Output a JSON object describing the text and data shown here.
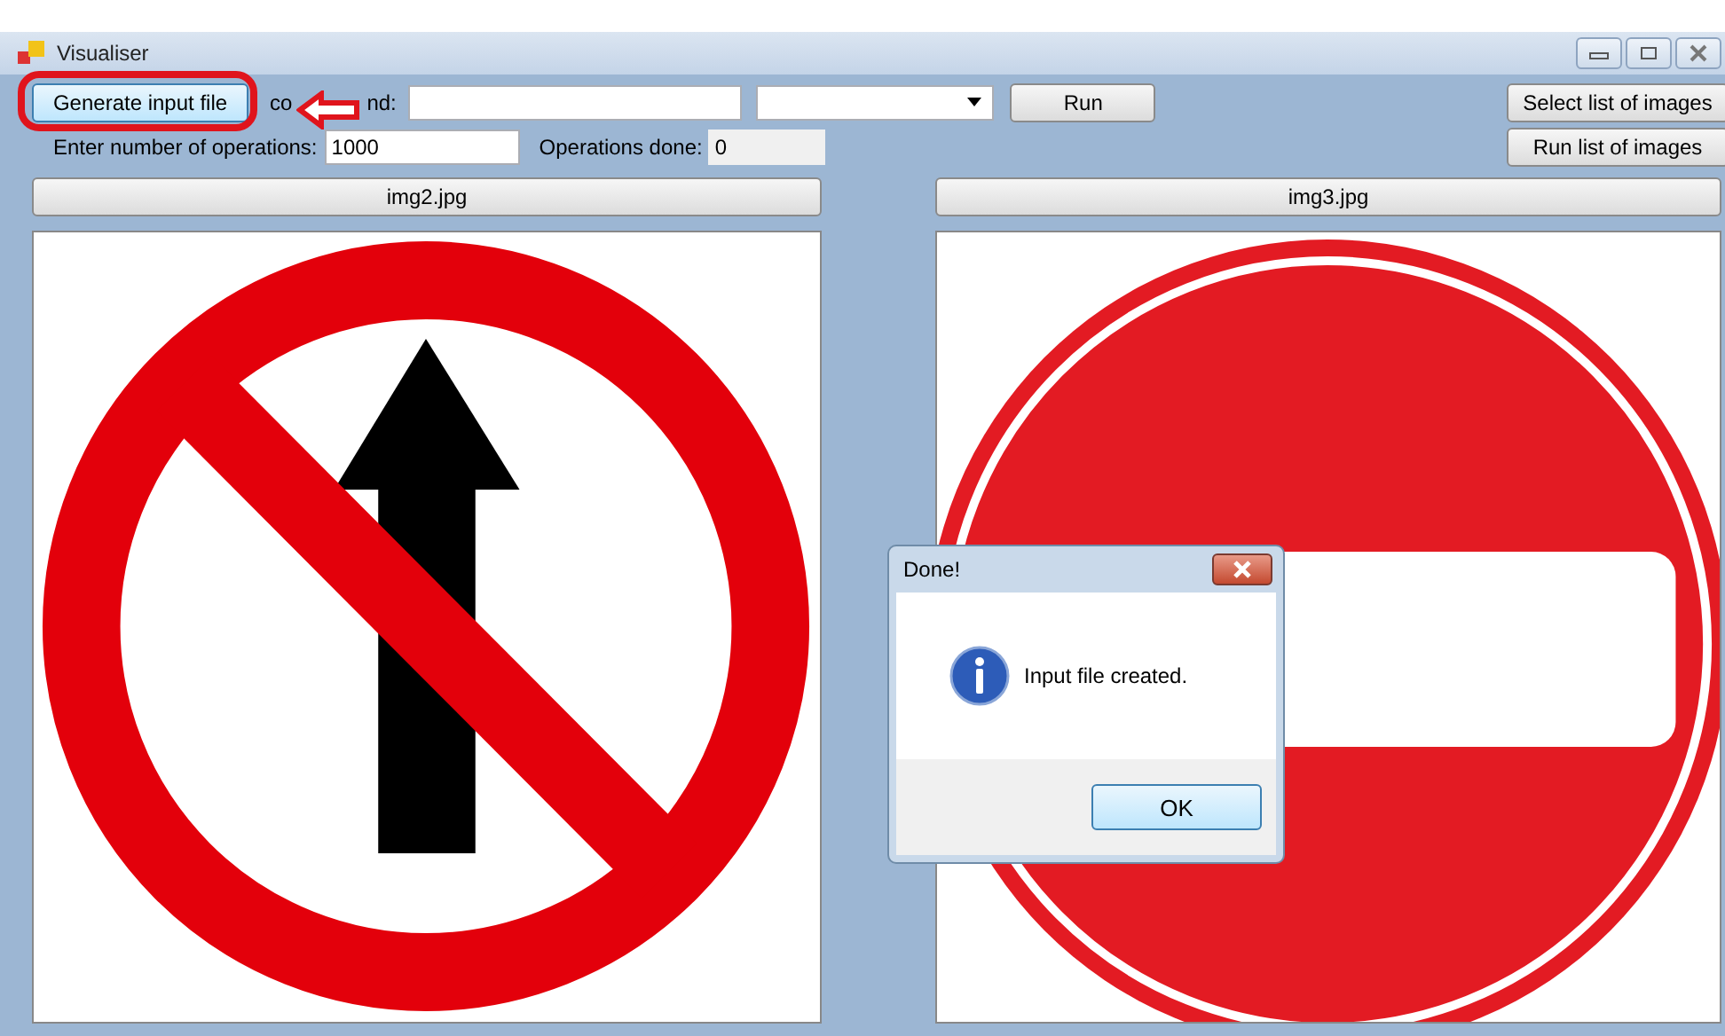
{
  "window": {
    "title": "Visualiser"
  },
  "toolbar": {
    "generate_button": "Generate input file",
    "command_label_parts": [
      "co",
      "nd:"
    ],
    "run_button": "Run",
    "select_list_button": "Select list of images",
    "run_list_button": "Run list of images"
  },
  "operations": {
    "label": "Enter number of operations:",
    "value": "1000",
    "done_label": "Operations done:",
    "done_value": "0"
  },
  "images": [
    {
      "name": "img2.jpg",
      "kind": "picture"
    },
    {
      "name": "img3.jpg",
      "kind": "picture"
    }
  ],
  "dialog": {
    "title": "Done!",
    "message": "Input file created.",
    "ok_button": "OK"
  }
}
